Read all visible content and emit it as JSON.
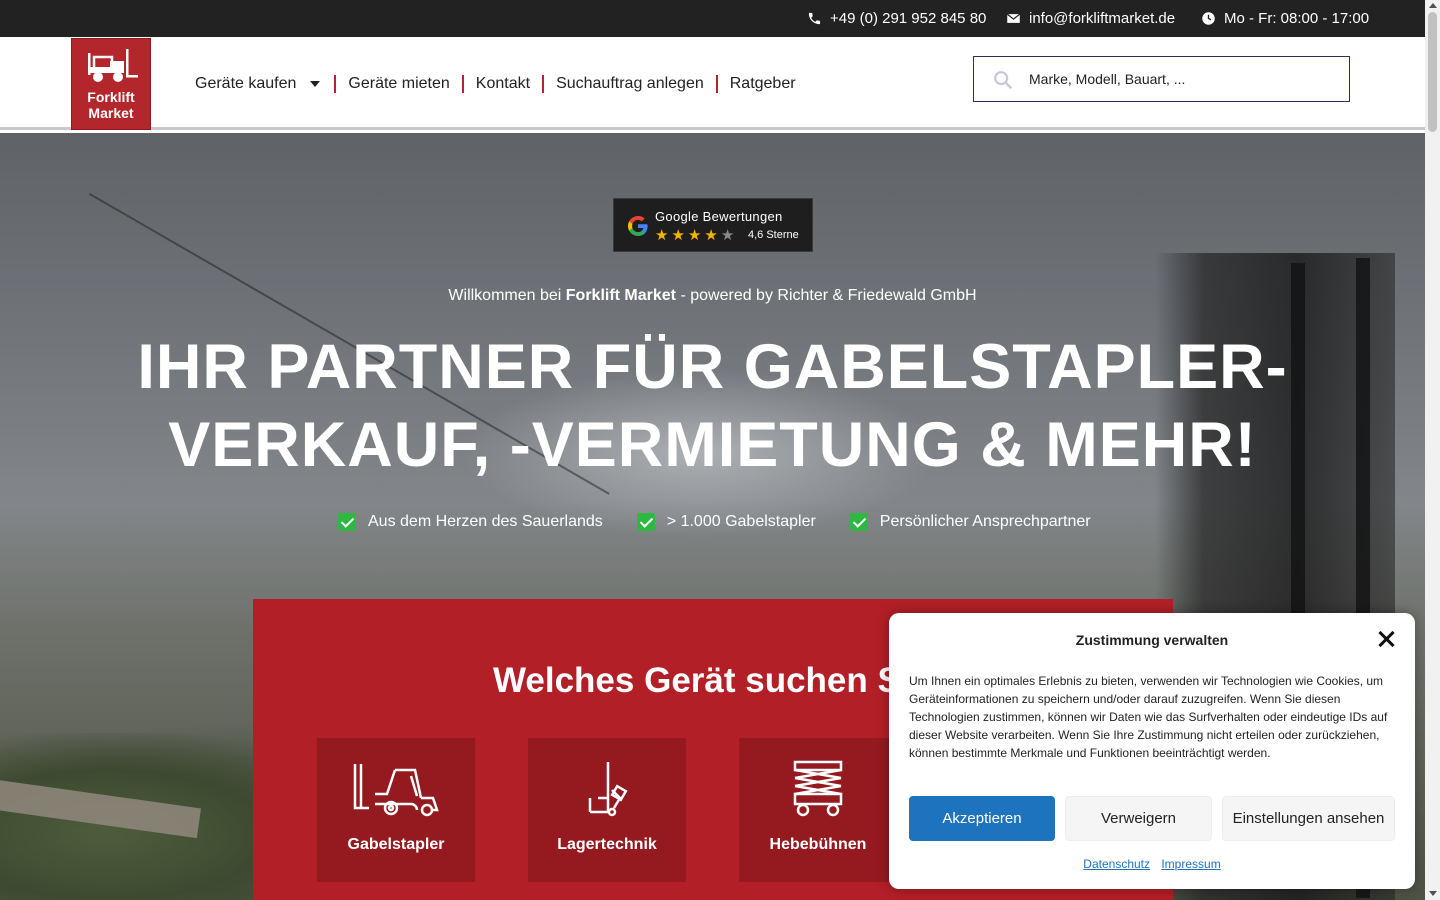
{
  "topbar": {
    "phone": "+49 (0) 291 952 845 80",
    "email": "info@forkliftmarket.de",
    "hours": "Mo - Fr: 08:00 - 17:00"
  },
  "header": {
    "logo": {
      "line1": "Forklift",
      "line2": "Market"
    },
    "nav": [
      {
        "label": "Geräte kaufen"
      },
      {
        "label": "Geräte mieten"
      },
      {
        "label": "Kontakt"
      },
      {
        "label": "Suchauftrag anlegen"
      },
      {
        "label": "Ratgeber"
      }
    ],
    "search": {
      "placeholder": "Marke, Modell, Bauart, ..."
    }
  },
  "hero": {
    "rating": {
      "title": "Google Bewertungen",
      "stars": 4.6,
      "score_label": "4,6 Sterne"
    },
    "welcome_prefix": "Willkommen bei ",
    "welcome_brand": "Forklift Market",
    "welcome_suffix": " - powered by Richter & Friedewald GmbH",
    "headline_line1": "IHR PARTNER FÜR GABELSTAPLER-",
    "headline_line2": "VERKAUF, -VERMIETUNG & MEHR!",
    "usps": [
      "Aus dem Herzen des Sauerlands",
      "> 1.000 Gabelstapler",
      "Persönlicher Ansprechpartner"
    ]
  },
  "panel": {
    "title": "Welches Gerät suchen Si",
    "categories": [
      {
        "label": "Gabelstapler",
        "icon": "forklift-icon"
      },
      {
        "label": "Lagertechnik",
        "icon": "pallet-jack-icon"
      },
      {
        "label": "Hebebühnen",
        "icon": "scissor-lift-icon"
      }
    ]
  },
  "consent": {
    "title": "Zustimmung verwalten",
    "text": "Um Ihnen ein optimales Erlebnis zu bieten, verwenden wir Technologien wie Cookies, um Geräteinformationen zu speichern und/oder darauf zuzugreifen. Wenn Sie diesen Technologien zustimmen, können wir Daten wie das Surfverhalten oder eindeutige IDs auf dieser Website verarbeiten. Wenn Sie Ihre Zustimmung nicht erteilen oder zurückziehen, können bestimmte Merkmale und Funktionen beeinträchtigt werden.",
    "accept": "Akzeptieren",
    "deny": "Verweigern",
    "preferences": "Einstellungen ansehen",
    "links": [
      "Datenschutz",
      "Impressum"
    ],
    "accent_color": "#1e73be"
  },
  "colors": {
    "brand_red": "#b31f26",
    "check_green": "#2db842",
    "topbar": "#222222"
  }
}
